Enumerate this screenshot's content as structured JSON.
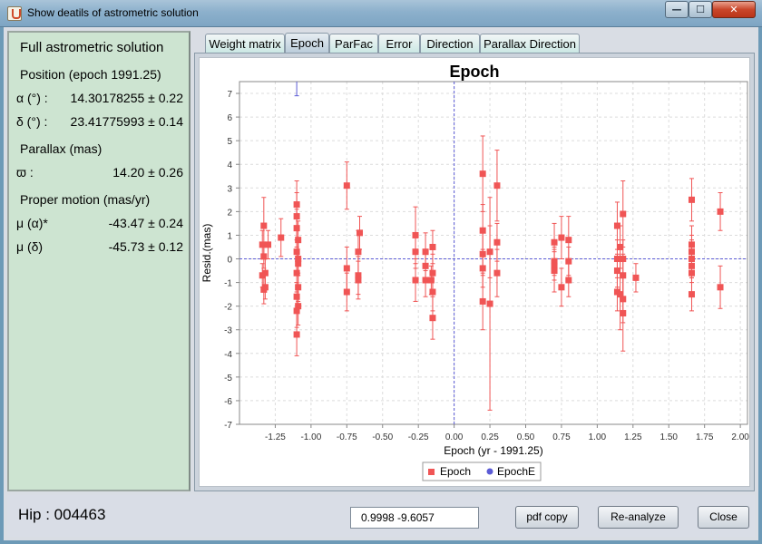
{
  "window": {
    "title": "Show deatils of astrometric solution",
    "buttons": {
      "minimize": "—",
      "maximize": "☐",
      "close": "✕"
    }
  },
  "solution": {
    "heading": "Full astrometric solution",
    "position_heading": "Position (epoch 1991.25)",
    "alpha_label": "α (°) :",
    "alpha_value": "14.30178255 ±  0.22",
    "delta_label": "δ (°) :",
    "delta_value": "23.41775993 ±  0.14",
    "parallax_heading": "Parallax (mas)",
    "parallax_label": "ϖ :",
    "parallax_value": "14.20 ±  0.26",
    "pm_heading": "Proper motion (mas/yr)",
    "pm_alpha_label": "μ (α)*",
    "pm_alpha_value": "-43.47 ±  0.24",
    "pm_delta_label": "μ (δ)",
    "pm_delta_value": "-45.73 ±  0.12"
  },
  "tabs": [
    "Weight matrix",
    "Epoch",
    "ParFac",
    "Error",
    "Direction",
    "Parallax Direction"
  ],
  "active_tab": "Epoch",
  "status": {
    "hip": "Hip : 004463",
    "coordinates": "0.9998   -9.6057",
    "pdf_button": "pdf copy",
    "reanalyze_button": "Re-analyze",
    "close_button": "Close"
  },
  "colors": {
    "epoch": "#f05555",
    "epochE": "#5b5bd6",
    "left_panel": "#cde4d1"
  },
  "chart_data": {
    "type": "scatter",
    "title": "Epoch",
    "xlabel": "Epoch (yr - 1991.25)",
    "ylabel": "Resid.(mas)",
    "xlim": [
      -1.5,
      2.05
    ],
    "ylim": [
      -7,
      7.5
    ],
    "xticks": [
      "-1.25",
      "-1.00",
      "-0.75",
      "-0.50",
      "-0.25",
      "0.00",
      "0.25",
      "0.50",
      "0.75",
      "1.00",
      "1.25",
      "1.50",
      "1.75",
      "2.00"
    ],
    "yticks": [
      "-7",
      "-6",
      "-5",
      "-4",
      "-3",
      "-2",
      "-1",
      "0",
      "1",
      "2",
      "3",
      "4",
      "5",
      "6",
      "7"
    ],
    "grid": true,
    "legend": "bottom",
    "series": [
      {
        "name": "Epoch",
        "points": [
          [
            -1.33,
            1.4,
            1.2
          ],
          [
            -1.34,
            0.6,
            0.6
          ],
          [
            -1.33,
            0.1,
            0.5
          ],
          [
            -1.34,
            -0.7,
            0.5
          ],
          [
            -1.33,
            -1.3,
            0.6
          ],
          [
            -1.32,
            -1.2,
            0.5
          ],
          [
            -1.32,
            -0.6,
            0.6
          ],
          [
            -1.3,
            0.6,
            0.6
          ],
          [
            -1.21,
            0.9,
            0.8
          ],
          [
            -1.1,
            2.3,
            1.0
          ],
          [
            -1.1,
            1.8,
            1.0
          ],
          [
            -1.1,
            1.3,
            0.8
          ],
          [
            -1.09,
            0.8,
            0.8
          ],
          [
            -1.1,
            0.3,
            0.9
          ],
          [
            -1.09,
            -0.2,
            1.0
          ],
          [
            -1.1,
            -0.6,
            0.8
          ],
          [
            -1.09,
            -1.2,
            0.6
          ],
          [
            -1.1,
            -1.6,
            0.6
          ],
          [
            -1.09,
            -2.0,
            0.8
          ],
          [
            -1.1,
            -2.2,
            0.7
          ],
          [
            -1.1,
            -3.2,
            0.9
          ],
          [
            -1.09,
            0.0,
            0.7
          ],
          [
            -0.75,
            3.1,
            1.0
          ],
          [
            -0.75,
            -0.4,
            0.9
          ],
          [
            -0.75,
            -1.4,
            0.8
          ],
          [
            -0.66,
            1.1,
            0.7
          ],
          [
            -0.67,
            0.3,
            0.9
          ],
          [
            -0.67,
            -0.7,
            0.8
          ],
          [
            -0.67,
            -0.9,
            0.8
          ],
          [
            -0.27,
            1.0,
            1.2
          ],
          [
            -0.27,
            0.3,
            0.7
          ],
          [
            -0.27,
            -0.9,
            0.9
          ],
          [
            -0.2,
            0.3,
            0.8
          ],
          [
            -0.2,
            -0.3,
            0.7
          ],
          [
            -0.2,
            -0.9,
            0.7
          ],
          [
            -0.15,
            0.5,
            0.7
          ],
          [
            -0.15,
            -0.6,
            0.8
          ],
          [
            -0.15,
            -1.4,
            0.8
          ],
          [
            -0.15,
            -2.5,
            0.9
          ],
          [
            -0.16,
            -0.9,
            0.6
          ],
          [
            0.2,
            3.6,
            1.6
          ],
          [
            0.2,
            1.2,
            1.1
          ],
          [
            0.2,
            0.2,
            0.9
          ],
          [
            0.2,
            -0.4,
            0.8
          ],
          [
            0.2,
            -1.8,
            1.2
          ],
          [
            0.25,
            0.3,
            1.1
          ],
          [
            0.25,
            -1.9,
            4.5
          ],
          [
            0.3,
            3.1,
            1.5
          ],
          [
            0.3,
            0.7,
            0.8
          ],
          [
            0.3,
            -0.6,
            1.0
          ],
          [
            0.7,
            0.7,
            0.8
          ],
          [
            0.7,
            -0.1,
            0.6
          ],
          [
            0.7,
            -0.3,
            0.6
          ],
          [
            0.7,
            -0.5,
            0.9
          ],
          [
            0.75,
            0.9,
            0.9
          ],
          [
            0.75,
            -1.2,
            0.8
          ],
          [
            0.8,
            0.8,
            1.0
          ],
          [
            0.8,
            -0.1,
            0.6
          ],
          [
            0.8,
            -0.9,
            0.7
          ],
          [
            1.14,
            1.4,
            1.0
          ],
          [
            1.14,
            0.0,
            0.8
          ],
          [
            1.14,
            -0.5,
            0.7
          ],
          [
            1.14,
            -1.4,
            0.8
          ],
          [
            1.16,
            0.5,
            0.9
          ],
          [
            1.16,
            -1.5,
            1.5
          ],
          [
            1.18,
            1.9,
            1.4
          ],
          [
            1.18,
            0.0,
            0.8
          ],
          [
            1.18,
            -0.7,
            0.9
          ],
          [
            1.18,
            -2.3,
            1.6
          ],
          [
            1.18,
            -1.7,
            1.0
          ],
          [
            1.27,
            -0.8,
            0.6
          ],
          [
            1.66,
            2.5,
            0.9
          ],
          [
            1.66,
            0.6,
            0.8
          ],
          [
            1.66,
            0.3,
            0.7
          ],
          [
            1.66,
            0.0,
            0.8
          ],
          [
            1.66,
            -0.3,
            0.7
          ],
          [
            1.66,
            -0.6,
            0.8
          ],
          [
            1.66,
            -1.5,
            0.7
          ],
          [
            1.86,
            2.0,
            0.8
          ],
          [
            1.86,
            -1.2,
            0.9
          ]
        ]
      },
      {
        "name": "EpochE",
        "points": [
          [
            -1.1,
            7.3,
            0.4
          ]
        ]
      }
    ]
  }
}
